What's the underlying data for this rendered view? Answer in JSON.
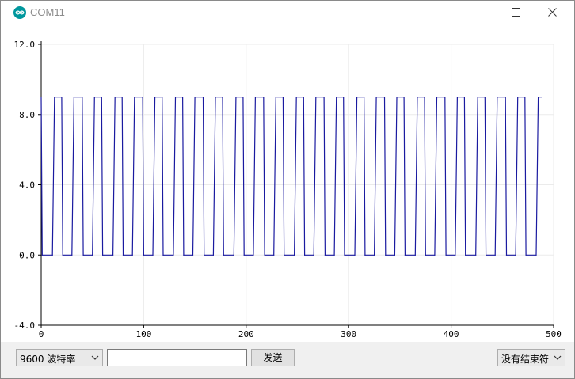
{
  "window": {
    "title": "COM11",
    "minimize_icon": "minimize-icon",
    "maximize_icon": "maximize-icon",
    "close_icon": "close-icon"
  },
  "chart_data": {
    "type": "line",
    "title": "",
    "xlabel": "",
    "ylabel": "",
    "xlim": [
      0,
      500
    ],
    "ylim": [
      -4,
      12
    ],
    "x_ticks": [
      "0",
      "100",
      "200",
      "300",
      "400",
      "500"
    ],
    "y_ticks": [
      "12.0",
      "8.0",
      "4.0",
      "0.0",
      "-4.0"
    ],
    "grid": true,
    "series": [
      {
        "color": "#1a1aa0",
        "points": [
          [
            0,
            9
          ],
          [
            1,
            0
          ],
          [
            11,
            0
          ],
          [
            13,
            9
          ],
          [
            20,
            9
          ],
          [
            21,
            0
          ],
          [
            30,
            0
          ],
          [
            32,
            9
          ],
          [
            40,
            9
          ],
          [
            41,
            0
          ],
          [
            50,
            0
          ],
          [
            52,
            9
          ],
          [
            59,
            9
          ],
          [
            60,
            0
          ],
          [
            70,
            0
          ],
          [
            72,
            9
          ],
          [
            79,
            9
          ],
          [
            80,
            0
          ],
          [
            89,
            0
          ],
          [
            91,
            9
          ],
          [
            99,
            9
          ],
          [
            100,
            0
          ],
          [
            109,
            0
          ],
          [
            111,
            9
          ],
          [
            118,
            9
          ],
          [
            119,
            0
          ],
          [
            129,
            0
          ],
          [
            131,
            9
          ],
          [
            138,
            9
          ],
          [
            139,
            0
          ],
          [
            148,
            0
          ],
          [
            150,
            9
          ],
          [
            158,
            9
          ],
          [
            159,
            0
          ],
          [
            168,
            0
          ],
          [
            170,
            9
          ],
          [
            177,
            9
          ],
          [
            178,
            0
          ],
          [
            188,
            0
          ],
          [
            190,
            9
          ],
          [
            197,
            9
          ],
          [
            198,
            0
          ],
          [
            207,
            0
          ],
          [
            209,
            9
          ],
          [
            217,
            9
          ],
          [
            218,
            0
          ],
          [
            227,
            0
          ],
          [
            229,
            9
          ],
          [
            236,
            9
          ],
          [
            237,
            0
          ],
          [
            247,
            0
          ],
          [
            249,
            9
          ],
          [
            256,
            9
          ],
          [
            257,
            0
          ],
          [
            266,
            0
          ],
          [
            268,
            9
          ],
          [
            276,
            9
          ],
          [
            277,
            0
          ],
          [
            286,
            0
          ],
          [
            288,
            9
          ],
          [
            295,
            9
          ],
          [
            296,
            0
          ],
          [
            306,
            0
          ],
          [
            308,
            9
          ],
          [
            315,
            9
          ],
          [
            316,
            0
          ],
          [
            325,
            0
          ],
          [
            327,
            9
          ],
          [
            335,
            9
          ],
          [
            336,
            0
          ],
          [
            345,
            0
          ],
          [
            347,
            9
          ],
          [
            354,
            9
          ],
          [
            355,
            0
          ],
          [
            365,
            0
          ],
          [
            367,
            9
          ],
          [
            374,
            9
          ],
          [
            375,
            0
          ],
          [
            384,
            0
          ],
          [
            386,
            9
          ],
          [
            394,
            9
          ],
          [
            395,
            0
          ],
          [
            404,
            0
          ],
          [
            406,
            9
          ],
          [
            413,
            9
          ],
          [
            414,
            0
          ],
          [
            424,
            0
          ],
          [
            426,
            9
          ],
          [
            433,
            9
          ],
          [
            434,
            0
          ],
          [
            443,
            0
          ],
          [
            445,
            9
          ],
          [
            453,
            9
          ],
          [
            454,
            0
          ],
          [
            463,
            0
          ],
          [
            465,
            9
          ],
          [
            472,
            9
          ],
          [
            473,
            0
          ],
          [
            483,
            0
          ],
          [
            485,
            9
          ],
          [
            488,
            9
          ]
        ]
      }
    ]
  },
  "bottom_bar": {
    "baud_value": "9600  波特率",
    "send_placeholder": "",
    "send_label": "发送",
    "line_ending_value": "没有结束符"
  },
  "colors": {
    "accent": "#00979d",
    "series": "#1a1aa0",
    "grid": "#ebebeb",
    "axis": "#000000"
  }
}
